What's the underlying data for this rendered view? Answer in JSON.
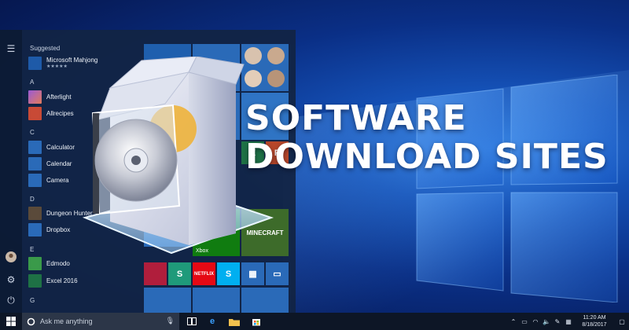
{
  "headline": {
    "line1": "SOFTWARE",
    "line2": "DOWNLOAD SITES"
  },
  "start_menu": {
    "suggested_label": "Suggested",
    "suggested_app": {
      "name": "Microsoft Mahjong",
      "rating": "★★★★★"
    },
    "sections": [
      {
        "letter": "A",
        "apps": [
          "Afterlight",
          "Allrecipes"
        ]
      },
      {
        "letter": "C",
        "apps": [
          "Calculator",
          "Calendar",
          "Camera"
        ]
      },
      {
        "letter": "D",
        "apps": [
          "Dungeon Hunter 5",
          "Dropbox"
        ]
      },
      {
        "letter": "E",
        "apps": [
          "Edmodo",
          "Excel 2016"
        ]
      },
      {
        "letter": "G",
        "apps": []
      }
    ],
    "tile_labels": {
      "xbox": "Xbox",
      "netflix": "NETFLIX",
      "minecraft": "MINECRAFT"
    }
  },
  "taskbar": {
    "search_placeholder": "Ask me anything",
    "clock_time": "11:20 AM",
    "clock_date": "8/18/2017"
  },
  "icons": {
    "start": "windows-icon",
    "search": "cortana-icon",
    "mic": "microphone-icon",
    "task_view": "task-view-icon",
    "edge": "edge-icon",
    "explorer": "folder-icon",
    "store": "store-icon"
  },
  "colors": {
    "desktop_blue": "#1552b8",
    "tile_blue": "#2a6ab8",
    "taskbar": "#0d1626",
    "headline": "#ffffff"
  }
}
